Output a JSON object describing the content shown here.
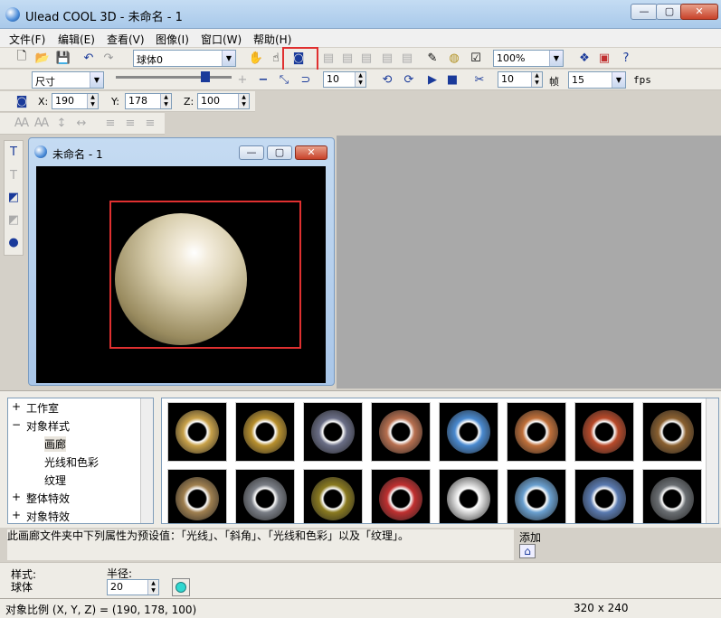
{
  "window": {
    "title": "Ulead COOL 3D - 未命名 - 1"
  },
  "menu": [
    "文件(F)",
    "编辑(E)",
    "查看(V)",
    "图像(I)",
    "窗口(W)",
    "帮助(H)"
  ],
  "toolbar1": {
    "object_combo": "球体0",
    "zoom_combo": "100%"
  },
  "toolbar2": {
    "attr_combo": "尺寸",
    "frame_spin": "10",
    "frame_count": "10",
    "frame_label": "帧",
    "fps_value": "15",
    "fps_label": "fps"
  },
  "toolbar3": {
    "x_label": "X:",
    "x_value": "190",
    "y_label": "Y:",
    "y_value": "178",
    "z_label": "Z:",
    "z_value": "100"
  },
  "document": {
    "title": "未命名 - 1"
  },
  "tree": [
    {
      "label": "工作室",
      "sign": "+"
    },
    {
      "label": "对象样式",
      "sign": "−"
    },
    {
      "label": "画廊",
      "sign": ""
    },
    {
      "label": "光线和色彩",
      "sign": ""
    },
    {
      "label": "纹理",
      "sign": ""
    },
    {
      "label": "整体特效",
      "sign": "+"
    },
    {
      "label": "对象特效",
      "sign": "+"
    }
  ],
  "gallery": {
    "row1": [
      "#c9a24a",
      "#b8902e",
      "#6a6e86",
      "#b87050",
      "#4a8ad0",
      "#c0703a",
      "#b84a2a",
      "#8a6030"
    ],
    "row2": [
      "#a08050",
      "#7a7e86",
      "#8a7a20",
      "#c03030",
      "#d8d8d8",
      "#6aa0d0",
      "#5a7ab0",
      "#6a6e72"
    ]
  },
  "description": "此画廊文件夹中下列属性为预设值：「光线」、「斜角」、「光线和色彩」以及「纹理」。",
  "add": {
    "label": "添加"
  },
  "style": {
    "label": "样式:",
    "value": "球体"
  },
  "radius": {
    "label": "半径:",
    "value": "20"
  },
  "status": {
    "text": "对象比例 (X, Y, Z) = (190, 178, 100)",
    "size": "320 x 240"
  }
}
